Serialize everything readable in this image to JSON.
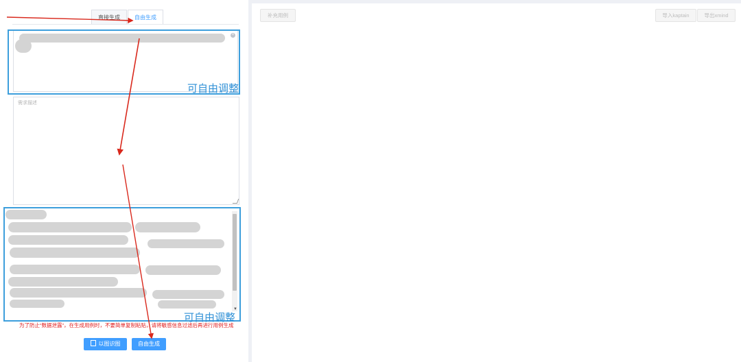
{
  "tabs": [
    {
      "label": "直接生成"
    },
    {
      "label": "自由生成"
    }
  ],
  "description": {
    "placeholder": "需求描述"
  },
  "annotation": {
    "label": "可自由调整"
  },
  "warning": {
    "text": "为了防止“数据泄露”，在生成用例时，不要简单复制粘贴，请将敏感信息过滤后再进行用例生成"
  },
  "buttons": {
    "import_label": "以图识图",
    "generate_label": "自由生成"
  },
  "toolbar": {
    "supplement_label": "补充用例",
    "import_kaptain_label": "导入kaptain",
    "export_xmind_label": "导出xmind"
  },
  "icons": {
    "clear": "clear-icon",
    "document": "document-icon",
    "scroll_down": "chevron-down-icon"
  },
  "colors": {
    "primary": "#409eff",
    "annotation_blue": "#3c9edc",
    "warning_red": "#e02020",
    "arrow_red": "#d9281c"
  }
}
